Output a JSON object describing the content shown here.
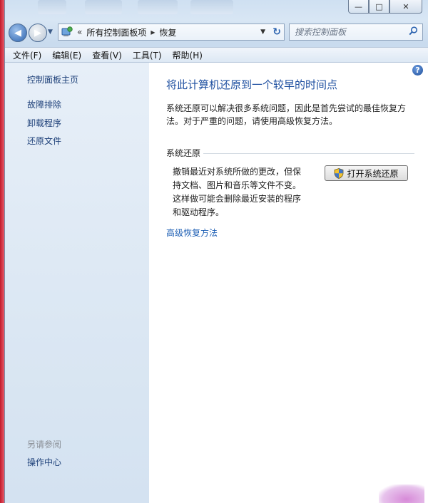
{
  "window": {
    "minimize_glyph": "—",
    "maximize_glyph": "□",
    "close_glyph": "✕"
  },
  "nav": {
    "back_glyph": "◀",
    "forward_glyph": "▶",
    "breadcrumbs_prefix": "«",
    "breadcrumb_1": "所有控制面板项",
    "breadcrumb_2": "恢复",
    "separator": "▸",
    "refresh_glyph": "↻",
    "search_placeholder": "搜索控制面板"
  },
  "menu": {
    "items": [
      "文件(F)",
      "编辑(E)",
      "查看(V)",
      "工具(T)",
      "帮助(H)"
    ]
  },
  "sidebar": {
    "home": "控制面板主页",
    "links": [
      "故障排除",
      "卸载程序",
      "还原文件"
    ],
    "see_also_heading": "另请参阅",
    "see_also_links": [
      "操作中心"
    ]
  },
  "main": {
    "help_glyph": "?",
    "title": "将此计算机还原到一个较早的时间点",
    "intro": "系统还原可以解决很多系统问题，因此是首先尝试的最佳恢复方法。对于严重的问题，请使用高级恢复方法。",
    "section_title": "系统还原",
    "section_desc": "撤销最近对系统所做的更改，但保持文档、图片和音乐等文件不变。这样做可能会删除最近安装的程序和驱动程序。",
    "open_button": "打开系统还原",
    "advanced_link": "高级恢复方法"
  },
  "colors": {
    "link": "#1c3f78",
    "title": "#1e4fa0",
    "accent_link": "#1e5fb4"
  }
}
